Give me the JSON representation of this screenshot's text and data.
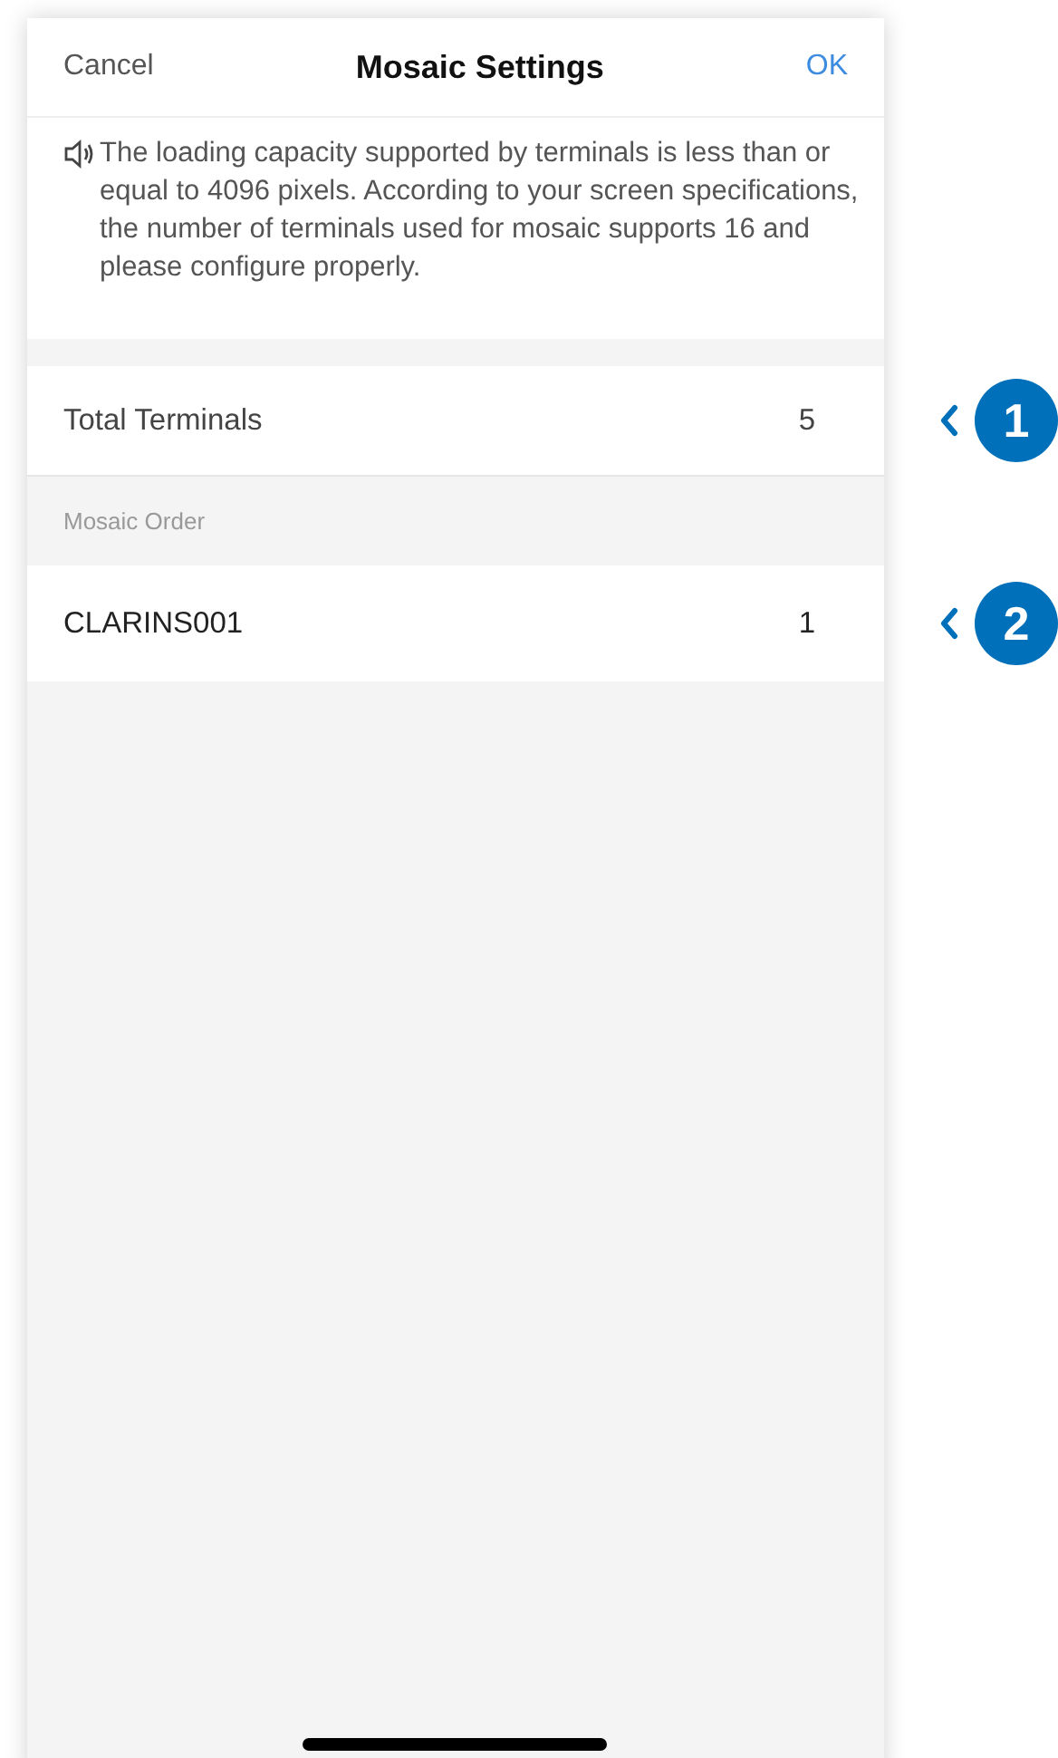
{
  "header": {
    "cancel": "Cancel",
    "title": "Mosaic Settings",
    "ok": "OK"
  },
  "notice": "The loading capacity supported by terminals is less than or equal to 4096 pixels. According to your screen specifications, the number of terminals used for mosaic supports 16 and please configure properly.",
  "total_terminals": {
    "label": "Total Terminals",
    "value": "5",
    "callout": "1"
  },
  "section_header": "Mosaic Order",
  "rows": [
    {
      "name": "CLARINS001",
      "order": "1",
      "callout": "2"
    }
  ]
}
